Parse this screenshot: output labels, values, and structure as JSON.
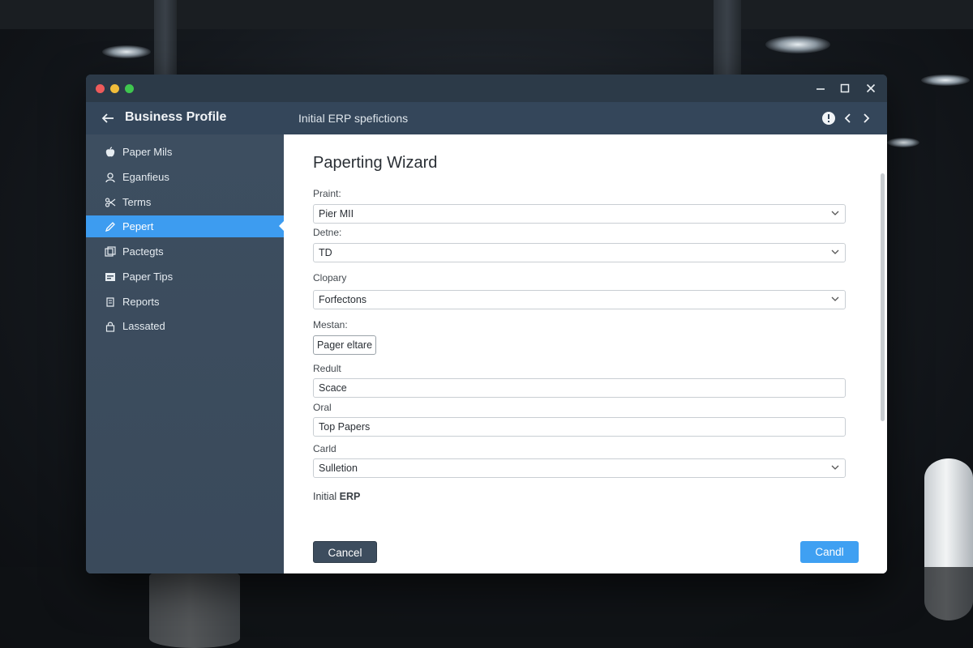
{
  "window": {
    "header": {
      "app_title": "Business Profile",
      "breadcrumb": "Initial ERP spefictions"
    }
  },
  "sidebar": {
    "items": [
      {
        "label": "Paper Mils",
        "icon": "apple-icon"
      },
      {
        "label": "Eganfieus",
        "icon": "user-icon"
      },
      {
        "label": "Terms",
        "icon": "scissors-icon"
      },
      {
        "label": "Pepert",
        "icon": "pencil-icon",
        "active": true
      },
      {
        "label": "Pactegts",
        "icon": "gallery-icon"
      },
      {
        "label": "Paper Tips",
        "icon": "card-icon"
      },
      {
        "label": "Reports",
        "icon": "report-icon"
      },
      {
        "label": "Lassated",
        "icon": "lock-icon"
      }
    ]
  },
  "wizard": {
    "title": "Paperting Wizard",
    "fields": [
      {
        "label": "Praint:",
        "value": "Pier MII",
        "type": "select"
      },
      {
        "label": "Detne:",
        "value": "TD",
        "type": "select"
      },
      {
        "label": "Clopary",
        "value": "Forfectons",
        "type": "select"
      },
      {
        "label": "Mestan:",
        "value": "Pager eltare",
        "type": "button"
      },
      {
        "label": "Redult",
        "value": "Scace",
        "type": "text"
      },
      {
        "label": "Oral",
        "value": "Top Papers",
        "type": "text"
      },
      {
        "label": "Carld",
        "value": "Sulletion",
        "type": "select"
      }
    ],
    "footer_note_prefix": "Initial",
    "footer_note_bold": "ERP"
  },
  "footer": {
    "cancel_label": "Cancel",
    "primary_label": "Candl"
  },
  "colors": {
    "accent": "#3d9cf0",
    "sidebar": "#3d4e60",
    "header": "#34465a",
    "titlebar": "#2c3a48"
  }
}
